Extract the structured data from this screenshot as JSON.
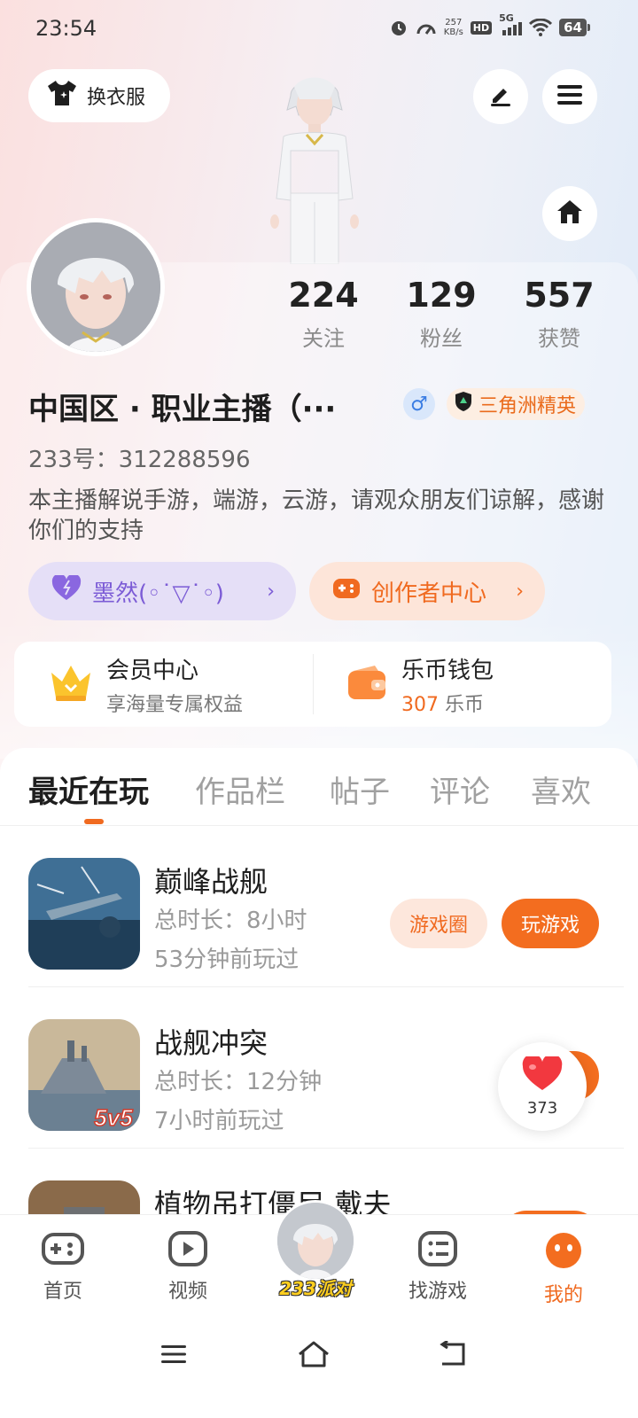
{
  "status_bar": {
    "time": "23:54",
    "net_speed_value": "257",
    "net_speed_unit": "KB/s",
    "hd": "HD",
    "signal": "5G",
    "battery": "64"
  },
  "header": {
    "outfit_label": "换衣服"
  },
  "profile": {
    "stats": [
      {
        "value": "224",
        "label": "关注"
      },
      {
        "value": "129",
        "label": "粉丝"
      },
      {
        "value": "557",
        "label": "获赞"
      }
    ],
    "name": "中国区 · 职业主播（···",
    "gender_symbol": "♂",
    "rank_label": "三角洲精英",
    "uid": "233号：312288596",
    "bio": "本主播解说手游，端游，云游，请观众朋友们谅解，感谢你们的支持",
    "mood_label": "墨然(◦˙▽˙◦)",
    "creator_label": "创作者中心"
  },
  "member_card": {
    "vip_title": "会员中心",
    "vip_sub": "享海量专属权益",
    "wallet_title": "乐币钱包",
    "wallet_amount": "307",
    "wallet_unit": "乐币"
  },
  "tabs": [
    "最近在玩",
    "作品栏",
    "帖子",
    "评论",
    "喜欢"
  ],
  "games": [
    {
      "name": "巅峰战舰",
      "duration": "总时长：8小时",
      "last_played": "53分钟前玩过",
      "circle_label": "游戏圈",
      "play_label": "玩游戏"
    },
    {
      "name": "战舰冲突",
      "duration": "总时长：12分钟",
      "last_played": "7小时前玩过",
      "badge": "5v5"
    },
    {
      "name": "植物吊打僵尸-戴夫"
    }
  ],
  "like_float": {
    "count": "373"
  },
  "bottom_nav": {
    "items": [
      "首页",
      "视频",
      "找游戏",
      "我的"
    ],
    "party_label": "233派对"
  },
  "colors": {
    "accent": "#f06a20",
    "mood": "#7c5cd6",
    "gender": "#3b7de3"
  }
}
